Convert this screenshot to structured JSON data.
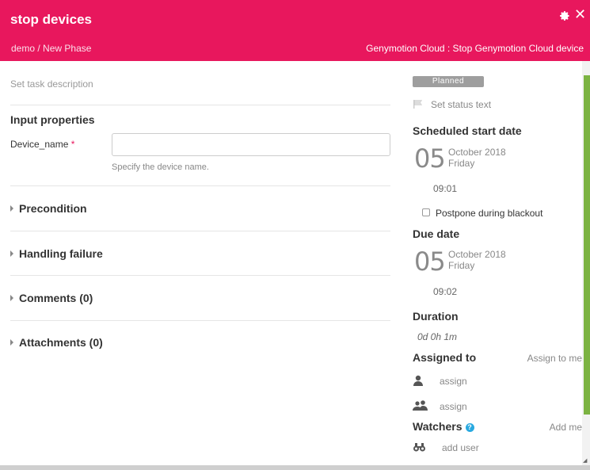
{
  "header": {
    "title": "stop devices",
    "breadcrumb": {
      "release": "demo",
      "separator": " / ",
      "phase": "New Phase"
    },
    "task_type": "Genymotion Cloud : Stop Genymotion Cloud device",
    "settings_icon": "gear-icon",
    "close_glyph": "✕"
  },
  "colors": {
    "header_bg": "#e8175d",
    "required": "#e8175d",
    "help": "#29a9e0",
    "scroll_accent": "#7cb342"
  },
  "main": {
    "description_placeholder": "Set task description",
    "input_properties_title": "Input properties",
    "fields": [
      {
        "label": "Device_name",
        "required_mark": "*",
        "value": "",
        "help": "Specify the device name."
      }
    ],
    "sections": [
      {
        "label": "Precondition"
      },
      {
        "label": "Handling failure"
      },
      {
        "label": "Comments (0)"
      },
      {
        "label": "Attachments (0)"
      }
    ]
  },
  "side": {
    "status_badge": "Planned",
    "status_text_placeholder": "Set status text",
    "scheduled": {
      "title": "Scheduled start date",
      "day": "05",
      "month_year": "October 2018",
      "weekday": "Friday",
      "time": "09:01"
    },
    "postpone_label": "Postpone during blackout",
    "due": {
      "title": "Due date",
      "day": "05",
      "month_year": "October 2018",
      "weekday": "Friday",
      "time": "09:02"
    },
    "duration": {
      "title": "Duration",
      "value": "0d 0h 1m"
    },
    "assigned": {
      "title": "Assigned to",
      "assign_to_me": "Assign to me",
      "user_assign": "assign",
      "team_assign": "assign"
    },
    "watchers": {
      "title": "Watchers",
      "add_me": "Add me",
      "add_user": "add user"
    }
  }
}
